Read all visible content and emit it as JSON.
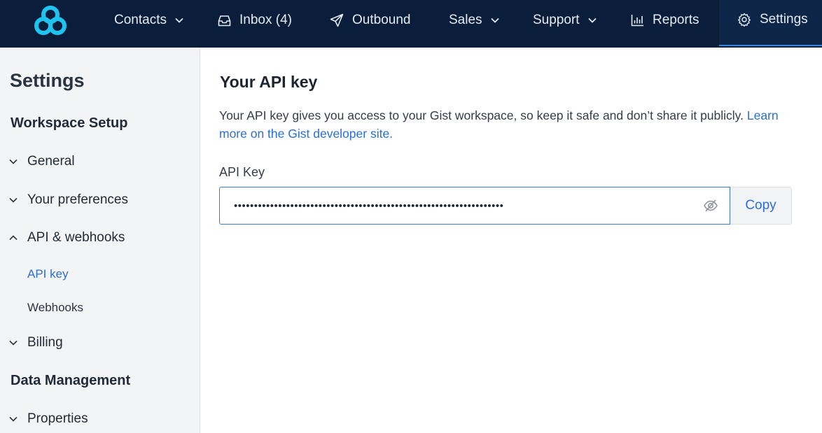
{
  "colors": {
    "nav_bg": "#0a1e3c",
    "nav_active_bg": "#0d2547",
    "accent": "#2a6fd6",
    "logo": "#1ec3f0",
    "sidebar_bg": "#f3f4f6"
  },
  "nav": {
    "logo_icon": "gist-logo-icon",
    "items": [
      {
        "label": "Contacts",
        "icon": "chevron-down-icon"
      },
      {
        "label": "Inbox (4)",
        "icon": "inbox-icon"
      },
      {
        "label": "Outbound",
        "icon": "paper-plane-icon"
      },
      {
        "label": "Sales",
        "icon": "chevron-down-icon"
      },
      {
        "label": "Support",
        "icon": "chevron-down-icon"
      },
      {
        "label": "Reports",
        "icon": "bar-chart-icon"
      },
      {
        "label": "Settings",
        "icon": "gear-icon"
      }
    ]
  },
  "sidebar": {
    "title": "Settings",
    "sections": [
      {
        "label": "Workspace Setup",
        "items": [
          {
            "label": "General",
            "icon": "chevron-down-icon"
          },
          {
            "label": "Your preferences",
            "icon": "chevron-down-icon"
          },
          {
            "label": "API & webhooks",
            "icon": "chevron-up-icon",
            "children": [
              {
                "label": "API key",
                "active": true
              },
              {
                "label": "Webhooks"
              }
            ]
          },
          {
            "label": "Billing",
            "icon": "chevron-down-icon"
          }
        ]
      },
      {
        "label": "Data Management",
        "items": [
          {
            "label": "Properties",
            "icon": "chevron-down-icon"
          }
        ]
      }
    ]
  },
  "main": {
    "title": "Your API key",
    "description": "Your API key gives you access to your Gist workspace, so keep it safe and don’t share it publicly.",
    "learn_more_link": "Learn more on the Gist developer site.",
    "field_label": "API Key",
    "api_key_masked": "•••••••••••••••••••••••••••••••••••••••••••••••••••••••••••••••••••",
    "toggle_icon": "eye-off-icon",
    "copy_label": "Copy"
  }
}
